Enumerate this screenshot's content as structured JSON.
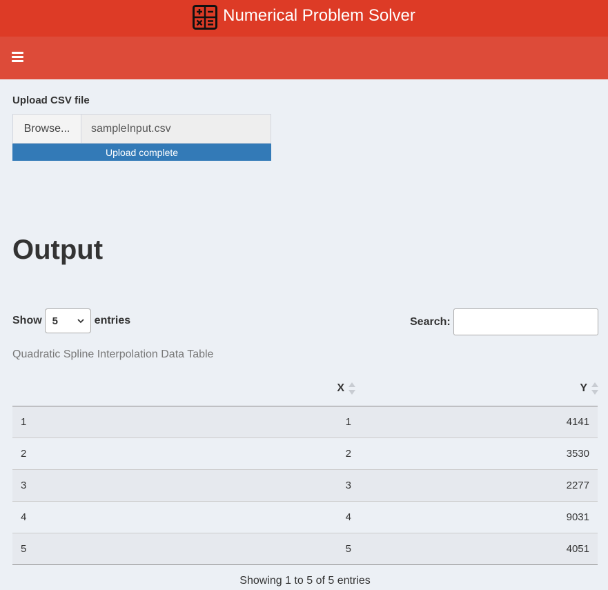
{
  "header": {
    "title": "Numerical Problem Solver",
    "logo_icon": "calculator-icon",
    "colors": {
      "header": "#dd3b26",
      "navbar": "#dd4b39",
      "progress": "#337ab7"
    }
  },
  "navbar": {
    "toggle_icon": "hamburger-menu-icon"
  },
  "upload": {
    "label": "Upload CSV file",
    "browse_label": "Browse...",
    "file_name": "sampleInput.csv",
    "progress_text": "Upload complete",
    "progress": 1.0
  },
  "output": {
    "heading": "Output"
  },
  "table_controls": {
    "show_label": "Show",
    "entries_label": "entries",
    "page_length": "5",
    "search_label": "Search:",
    "search_value": ""
  },
  "table": {
    "caption": "Quadratic Spline Interpolation Data Table",
    "columns": [
      "",
      "X",
      "Y"
    ],
    "rows": [
      [
        "1",
        "1",
        "4141"
      ],
      [
        "2",
        "2",
        "3530"
      ],
      [
        "3",
        "3",
        "2277"
      ],
      [
        "4",
        "4",
        "9031"
      ],
      [
        "5",
        "5",
        "4051"
      ]
    ],
    "info": "Showing 1 to 5 of 5 entries"
  }
}
